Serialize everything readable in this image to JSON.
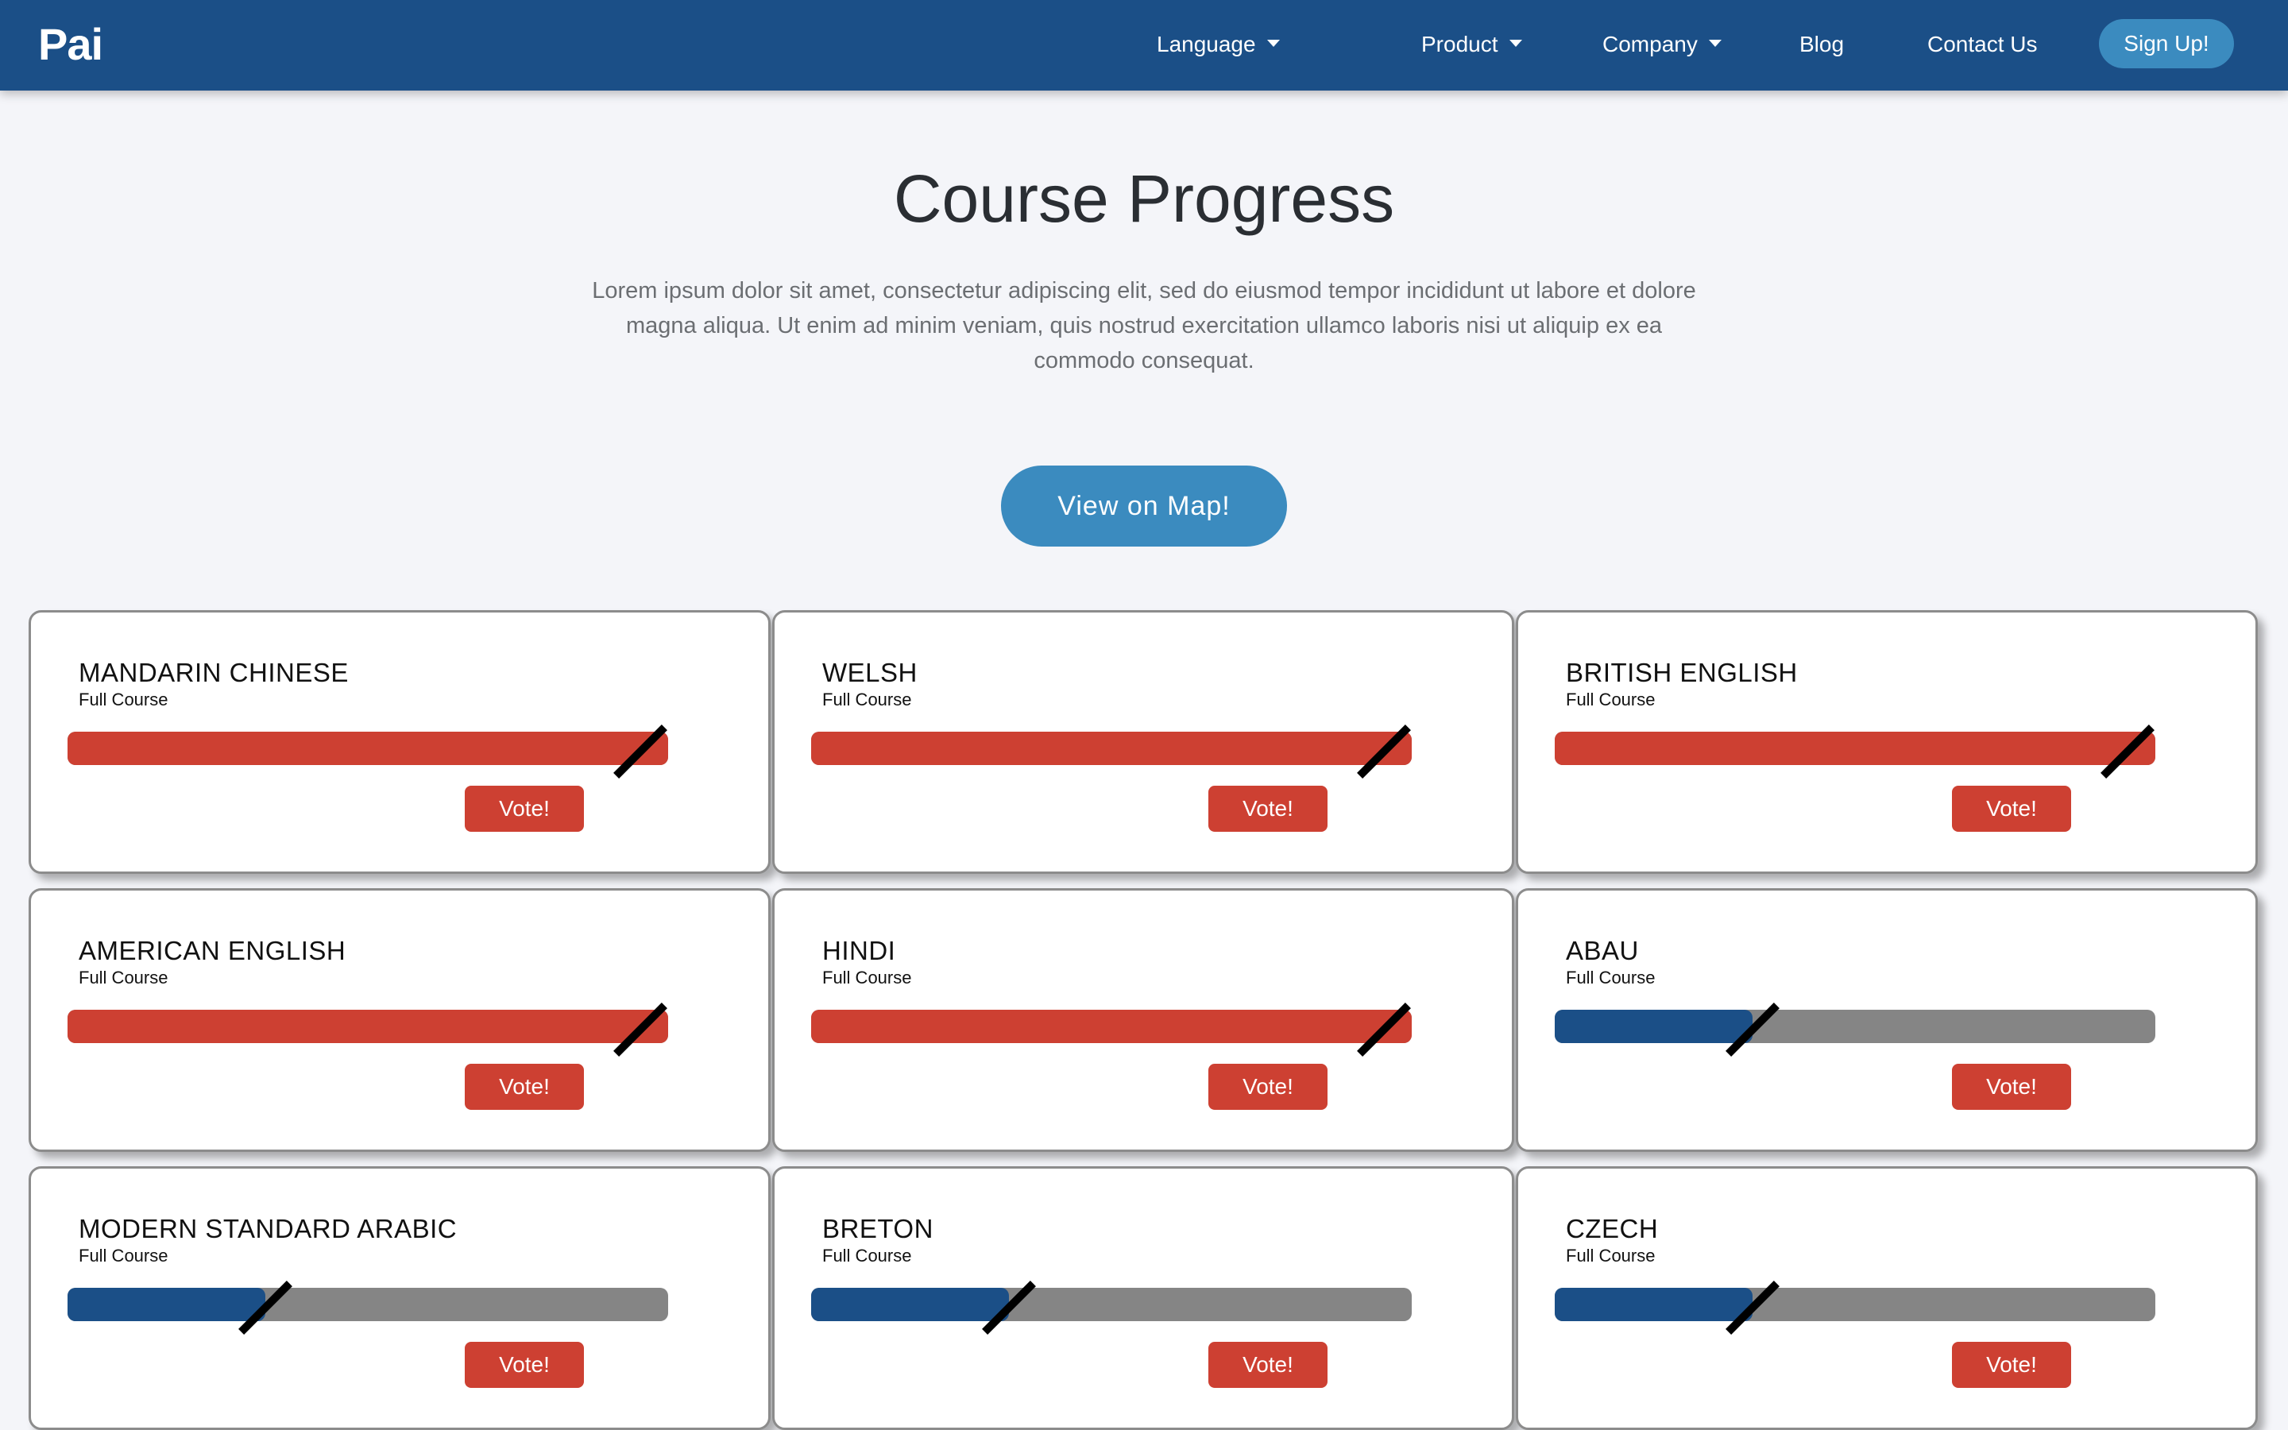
{
  "navbar": {
    "logo": "Pai",
    "items": [
      {
        "label": "Language"
      },
      {
        "label": "Product"
      },
      {
        "label": "Company"
      },
      {
        "label": "Blog"
      },
      {
        "label": "Contact Us"
      }
    ],
    "signup_label": "Sign Up!"
  },
  "hero": {
    "title": "Course Progress",
    "intro": "Lorem ipsum dolor sit amet, consectetur adipiscing elit, sed do eiusmod tempor incididunt ut labore et dolore magna aliqua. Ut enim ad minim veniam, quis nostrud exercitation ullamco laboris nisi ut aliquip ex ea commodo consequat.",
    "map_button": "View on Map!"
  },
  "colors": {
    "navbar": "#1b4f87",
    "accent": "#3b8bbf",
    "bar_full": "#cd4032",
    "bar_partial": "#1b4f87",
    "bar_track": "#858585",
    "vote": "#cd4032"
  },
  "courses": [
    {
      "name": "MANDARIN CHINESE",
      "subtitle": "Full Course",
      "progress": 1.0,
      "vote_label": "Vote!"
    },
    {
      "name": "WELSH",
      "subtitle": "Full Course",
      "progress": 1.0,
      "vote_label": "Vote!"
    },
    {
      "name": "BRITISH ENGLISH",
      "subtitle": "Full Course",
      "progress": 1.0,
      "vote_label": "Vote!"
    },
    {
      "name": "AMERICAN ENGLISH",
      "subtitle": "Full Course",
      "progress": 1.0,
      "vote_label": "Vote!"
    },
    {
      "name": "HINDI",
      "subtitle": "Full Course",
      "progress": 1.0,
      "vote_label": "Vote!"
    },
    {
      "name": "ABAU",
      "subtitle": "Full Course",
      "progress": 0.33,
      "vote_label": "Vote!"
    },
    {
      "name": "MODERN STANDARD ARABIC",
      "subtitle": "Full Course",
      "progress": 0.33,
      "vote_label": "Vote!"
    },
    {
      "name": "BRETON",
      "subtitle": "Full Course",
      "progress": 0.33,
      "vote_label": "Vote!"
    },
    {
      "name": "CZECH",
      "subtitle": "Full Course",
      "progress": 0.33,
      "vote_label": "Vote!"
    }
  ]
}
